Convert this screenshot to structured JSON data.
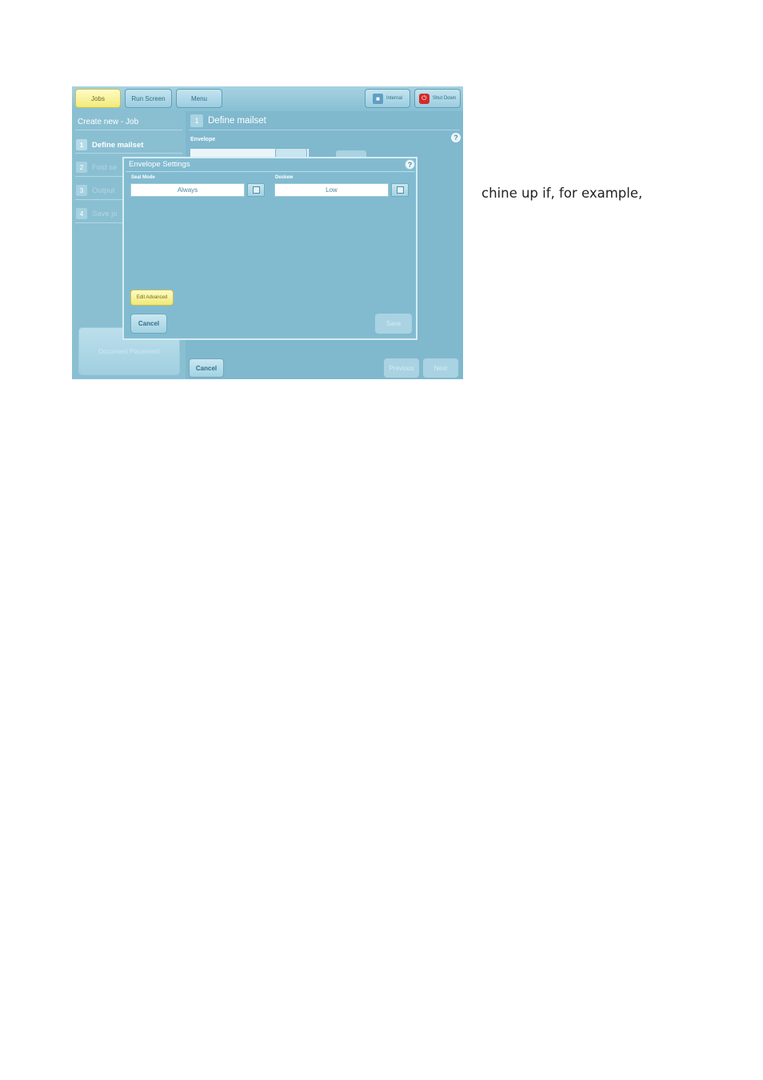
{
  "toolbar": {
    "jobs_label": "Jobs",
    "run_screen_label": "Run Screen",
    "menu_label": "Menu",
    "internal_label": "Internal",
    "shutdown_label": "Shut Down",
    "internal_icon": "lock-icon",
    "shutdown_icon": "power-icon"
  },
  "left_panel": {
    "title": "Create new - Job",
    "steps": [
      {
        "num": "1",
        "label": "Define mailset"
      },
      {
        "num": "2",
        "label": "Fold se"
      },
      {
        "num": "3",
        "label": "Output"
      },
      {
        "num": "4",
        "label": "Save jo"
      }
    ],
    "document_placement_label": "Document Placement"
  },
  "main_panel": {
    "step_num": "1",
    "title": "Define mailset",
    "envelope_label": "Envelope",
    "cancel_label": "Cancel",
    "previous_label": "Previous",
    "next_label": "Next"
  },
  "dialog": {
    "title": "Envelope Settings",
    "seal_mode_label": "Seal Mode",
    "seal_mode_value": "Always",
    "second_label": "Deskew",
    "second_value": "Low",
    "edit_advanced_label": "Edit Advanced",
    "cancel_label": "Cancel",
    "save_label": "Save"
  },
  "side_text": "chine up if, for example,",
  "colors": {
    "screen_bg": "#80b8ce",
    "active_button": "#f7f19a",
    "shutdown_red": "#d42a2a"
  }
}
